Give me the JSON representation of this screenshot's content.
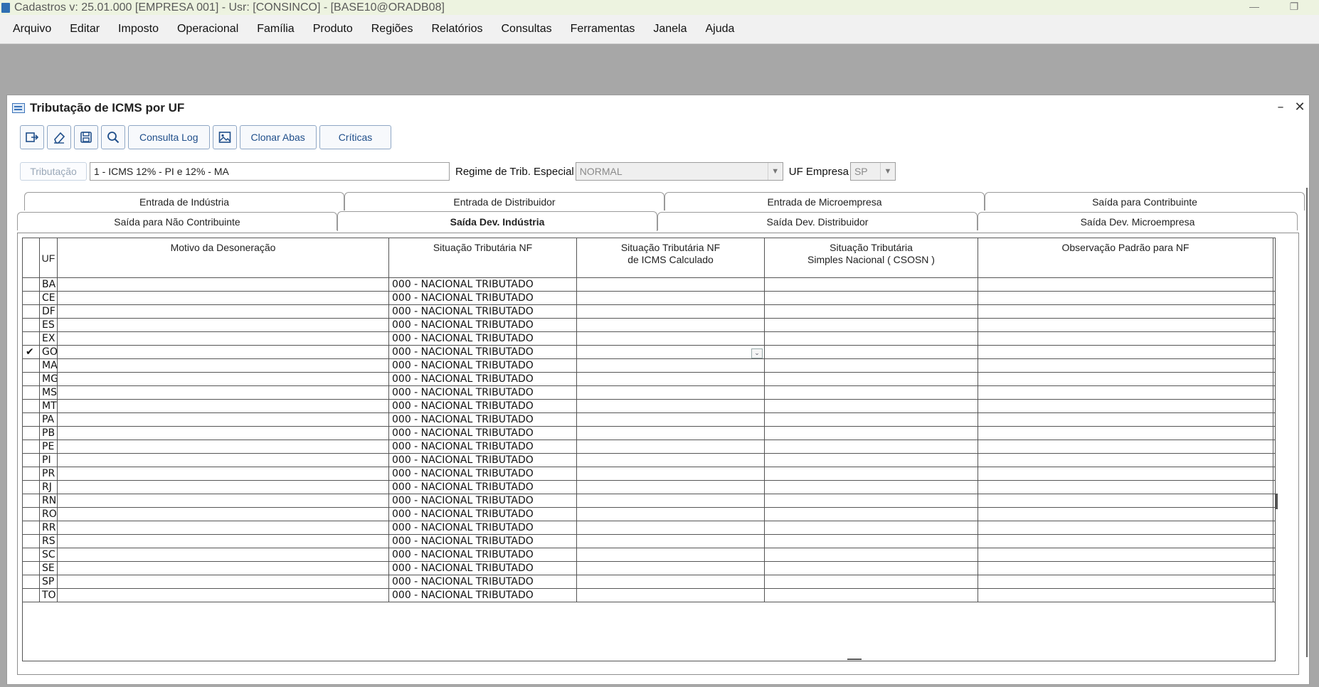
{
  "window": {
    "title": "Cadastros  v: 25.01.000   [EMPRESA 001] - Usr: [CONSINCO] - [BASE10@ORADB08]"
  },
  "menu": [
    "Arquivo",
    "Editar",
    "Imposto",
    "Operacional",
    "Família",
    "Produto",
    "Regiões",
    "Relatórios",
    "Consultas",
    "Ferramentas",
    "Janela",
    "Ajuda"
  ],
  "form": {
    "title": "Tributação de ICMS por UF",
    "toolbar": {
      "consulta_log": "Consulta Log",
      "clonar_abas": "Clonar Abas",
      "criticas": "Críticas"
    },
    "tributacao_label": "Tributação",
    "tributacao_value": "1  -  ICMS 12% - PI e 12% - MA",
    "regime_label": "Regime de Trib. Especial",
    "regime_value": "NORMAL",
    "uf_empresa_label": "UF Empresa",
    "uf_empresa_value": "SP"
  },
  "tabs_row1": [
    "Entrada de Indústria",
    "Entrada de Distribuidor",
    "Entrada de Microempresa",
    "Saída para Contribuinte"
  ],
  "tabs_row2": [
    "Saída para Não Contribuinte",
    "Saída Dev. Indústria",
    "Saída Dev. Distribuidor",
    "Saída Dev. Microempresa"
  ],
  "active_tab": "Saída Dev. Indústria",
  "grid": {
    "headers": {
      "uf": "UF",
      "motivo": "Motivo da Desoneração",
      "situacao": "Situação Tributária NF",
      "situacao_calc_1": "Situação Tributária NF",
      "situacao_calc_2": "de ICMS Calculado",
      "csosn_1": "Situação Tributária",
      "csosn_2": "Simples Nacional ( CSOSN )",
      "obs": "Observação Padrão para NF"
    },
    "selected_uf": "GO",
    "rows": [
      {
        "uf": "BA",
        "situacao": "000 - NACIONAL TRIBUTADO"
      },
      {
        "uf": "CE",
        "situacao": "000 - NACIONAL TRIBUTADO"
      },
      {
        "uf": "DF",
        "situacao": "000 - NACIONAL TRIBUTADO"
      },
      {
        "uf": "ES",
        "situacao": "000 - NACIONAL TRIBUTADO"
      },
      {
        "uf": "EX",
        "situacao": "000 - NACIONAL TRIBUTADO"
      },
      {
        "uf": "GO",
        "situacao": "000 - NACIONAL TRIBUTADO"
      },
      {
        "uf": "MA",
        "situacao": "000 - NACIONAL TRIBUTADO"
      },
      {
        "uf": "MG",
        "situacao": "000 - NACIONAL TRIBUTADO"
      },
      {
        "uf": "MS",
        "situacao": "000 - NACIONAL TRIBUTADO"
      },
      {
        "uf": "MT",
        "situacao": "000 - NACIONAL TRIBUTADO"
      },
      {
        "uf": "PA",
        "situacao": "000 - NACIONAL TRIBUTADO"
      },
      {
        "uf": "PB",
        "situacao": "000 - NACIONAL TRIBUTADO"
      },
      {
        "uf": "PE",
        "situacao": "000 - NACIONAL TRIBUTADO"
      },
      {
        "uf": "PI",
        "situacao": "000 - NACIONAL TRIBUTADO"
      },
      {
        "uf": "PR",
        "situacao": "000 - NACIONAL TRIBUTADO"
      },
      {
        "uf": "RJ",
        "situacao": "000 - NACIONAL TRIBUTADO"
      },
      {
        "uf": "RN",
        "situacao": "000 - NACIONAL TRIBUTADO"
      },
      {
        "uf": "RO",
        "situacao": "000 - NACIONAL TRIBUTADO"
      },
      {
        "uf": "RR",
        "situacao": "000 - NACIONAL TRIBUTADO"
      },
      {
        "uf": "RS",
        "situacao": "000 - NACIONAL TRIBUTADO"
      },
      {
        "uf": "SC",
        "situacao": "000 - NACIONAL TRIBUTADO"
      },
      {
        "uf": "SE",
        "situacao": "000 - NACIONAL TRIBUTADO"
      },
      {
        "uf": "SP",
        "situacao": "000 - NACIONAL TRIBUTADO"
      },
      {
        "uf": "TO",
        "situacao": "000 - NACIONAL TRIBUTADO"
      }
    ]
  },
  "icons": {
    "exit": "exit-icon",
    "clear": "eraser-icon",
    "save": "save-icon",
    "search": "search-icon",
    "image": "image-icon",
    "check": "checkmark-icon"
  },
  "colors": {
    "titlebar_bg": "#edf3e0",
    "mdi_bg": "#a7a7a7",
    "button_text": "#1f4e8a"
  }
}
